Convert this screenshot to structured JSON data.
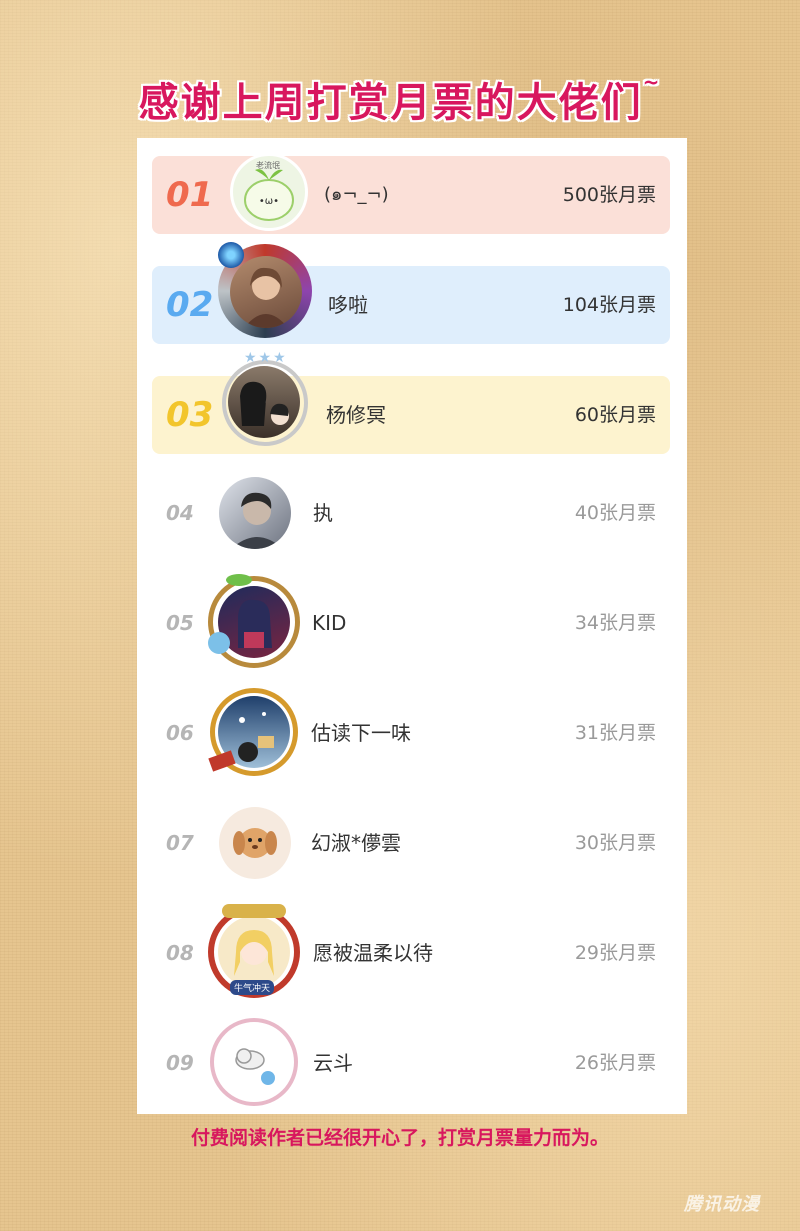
{
  "title": "感谢上周打赏月票的大佬们",
  "title_tilde": "~",
  "footer": "付费阅读作者已经很开心了，打赏月票量力而为。",
  "watermark": "腾讯动漫",
  "colors": {
    "accent": "#d8175e",
    "row1_bg": "#fbe0d8",
    "row2_bg": "#dfeefc",
    "row3_bg": "#fdf3cf",
    "rank1": "#ef6a4e",
    "rank2": "#5aaaf0",
    "rank3": "#f2c52c"
  },
  "entries": [
    {
      "rank": "01",
      "name": "(๑¬_¬)",
      "votes": "500张月票",
      "avatar_label": "老流氓",
      "avatar_icon": "sprout-face-icon"
    },
    {
      "rank": "02",
      "name": "哆啦",
      "votes": "104张月票",
      "avatar_icon": "portrait-photo-icon"
    },
    {
      "rank": "03",
      "name": "杨修冥",
      "votes": "60张月票",
      "avatar_icon": "anime-characters-icon"
    },
    {
      "rank": "04",
      "name": "执",
      "votes": "40张月票",
      "avatar_icon": "person-photo-icon"
    },
    {
      "rank": "05",
      "name": "KID",
      "votes": "34张月票",
      "avatar_icon": "anime-girl-icon"
    },
    {
      "rank": "06",
      "name": "估读下一味",
      "votes": "31张月票",
      "avatar_icon": "sky-scene-icon"
    },
    {
      "rank": "07",
      "name": "幻淑*儚雲",
      "votes": "30张月票",
      "avatar_icon": "puppy-icon"
    },
    {
      "rank": "08",
      "name": "愿被温柔以待",
      "votes": "29张月票",
      "avatar_label": "牛气冲天",
      "avatar_icon": "blonde-girl-icon"
    },
    {
      "rank": "09",
      "name": "云斗",
      "votes": "26张月票",
      "avatar_icon": "cloud-bird-icon"
    }
  ]
}
